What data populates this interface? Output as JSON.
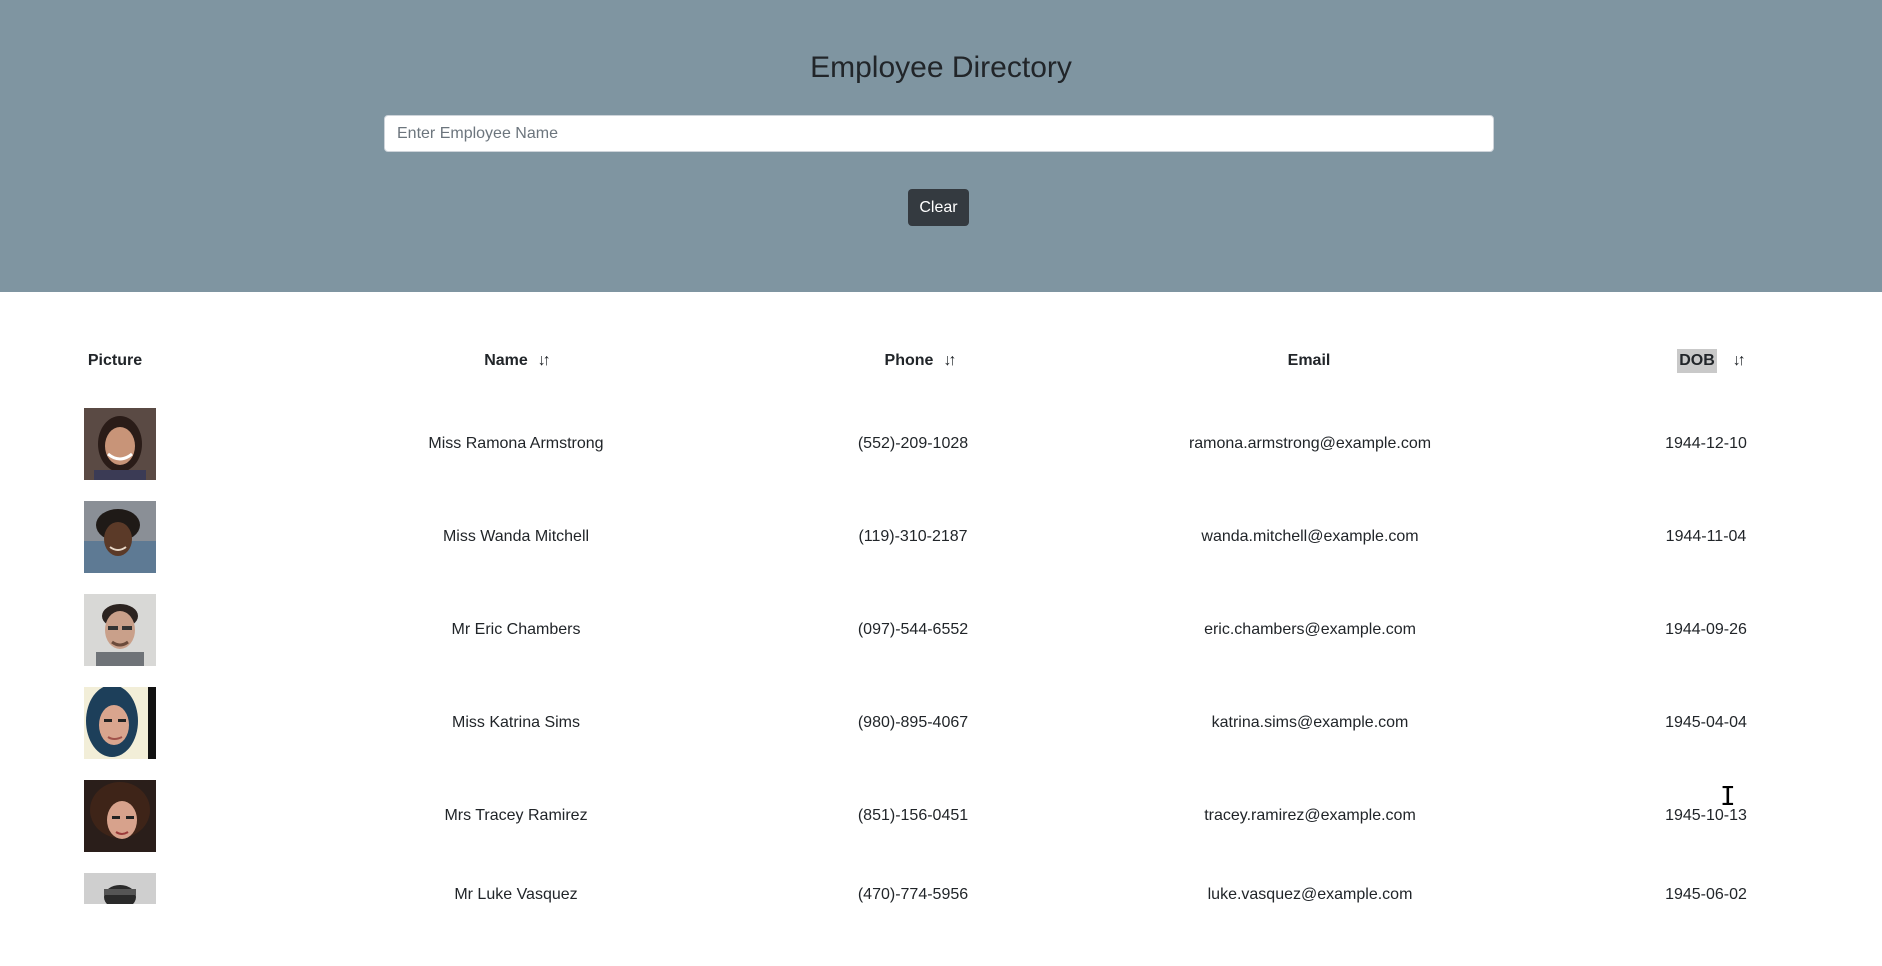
{
  "header": {
    "title": "Employee Directory",
    "search_placeholder": "Enter Employee Name",
    "search_value": "",
    "clear_label": "Clear",
    "background_color": "#7f95a1"
  },
  "table": {
    "columns": [
      {
        "label": "Picture",
        "sortable": false
      },
      {
        "label": "Name",
        "sortable": true
      },
      {
        "label": "Phone",
        "sortable": true
      },
      {
        "label": "Email",
        "sortable": false
      },
      {
        "label": "DOB",
        "sortable": true,
        "highlighted": true
      }
    ],
    "sort_icon": "sort-arrows-icon",
    "rows": [
      {
        "name": "Miss Ramona Armstrong",
        "phone": "(552)-209-1028",
        "email": "ramona.armstrong@example.com",
        "dob": "1944-12-10"
      },
      {
        "name": "Miss Wanda Mitchell",
        "phone": "(119)-310-2187",
        "email": "wanda.mitchell@example.com",
        "dob": "1944-11-04"
      },
      {
        "name": "Mr Eric Chambers",
        "phone": "(097)-544-6552",
        "email": "eric.chambers@example.com",
        "dob": "1944-09-26"
      },
      {
        "name": "Miss Katrina Sims",
        "phone": "(980)-895-4067",
        "email": "katrina.sims@example.com",
        "dob": "1945-04-04"
      },
      {
        "name": "Mrs Tracey Ramirez",
        "phone": "(851)-156-0451",
        "email": "tracey.ramirez@example.com",
        "dob": "1945-10-13"
      },
      {
        "name": "Mr Luke Vasquez",
        "phone": "(470)-774-5956",
        "email": "luke.vasquez@example.com",
        "dob": "1945-06-02"
      }
    ]
  }
}
